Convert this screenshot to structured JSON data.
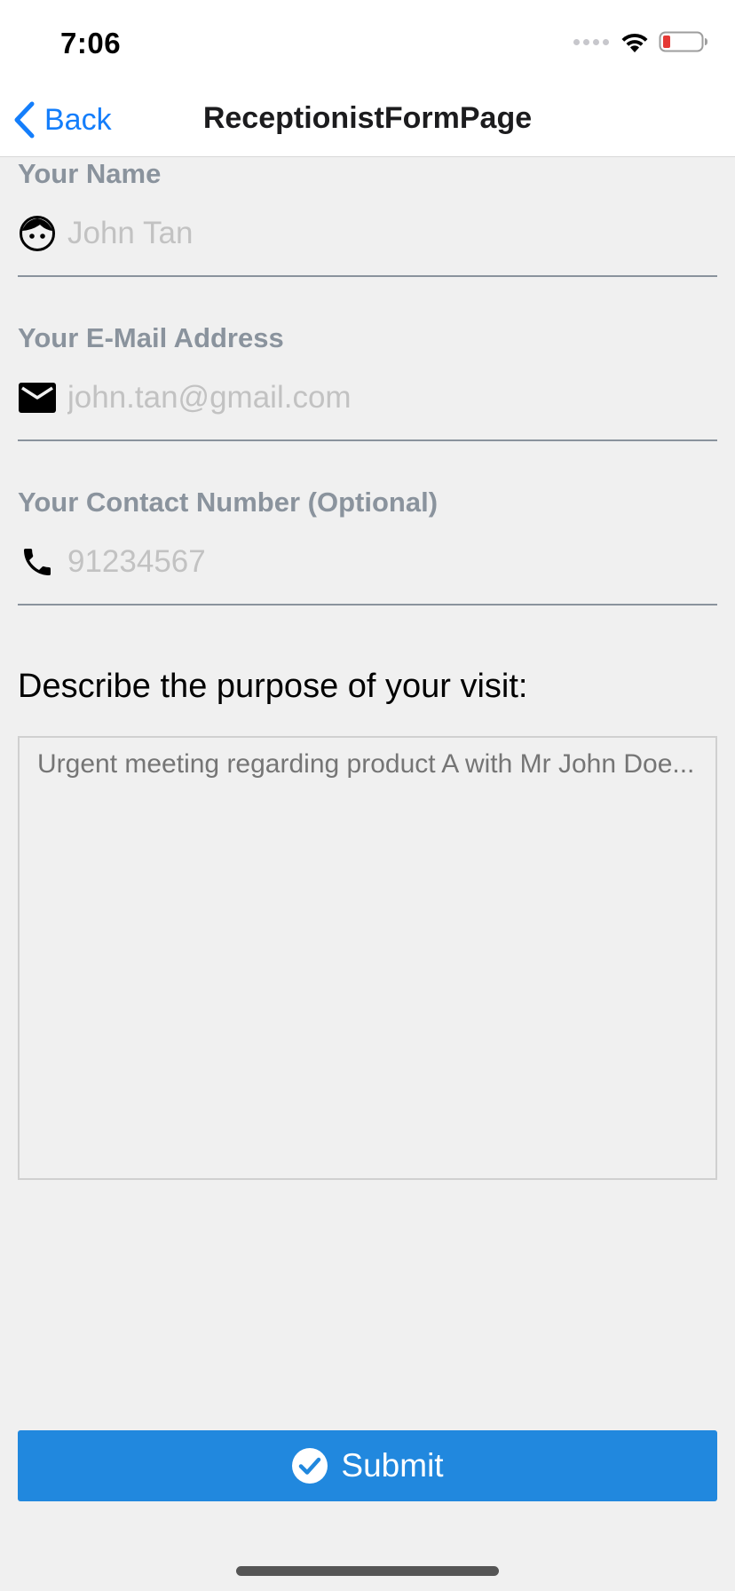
{
  "status_bar": {
    "time": "7:06",
    "icons": [
      "signal-dots-icon",
      "wifi-icon",
      "battery-low-icon"
    ],
    "battery_color": "#e53935"
  },
  "nav": {
    "back_label": "Back",
    "title": "ReceptionistFormPage",
    "accent_color": "#147efb"
  },
  "form": {
    "name": {
      "label": "Your Name",
      "placeholder": "John Tan",
      "value": "",
      "icon": "face-icon"
    },
    "email": {
      "label": "Your E-Mail Address",
      "placeholder": "john.tan@gmail.com",
      "value": "",
      "icon": "mail-icon"
    },
    "phone": {
      "label": "Your Contact Number (Optional)",
      "placeholder": "91234567",
      "value": "",
      "icon": "phone-icon"
    },
    "purpose": {
      "label": "Describe the purpose of your visit:",
      "placeholder": "Urgent meeting regarding product A with Mr John Doe...",
      "value": ""
    },
    "submit_label": "Submit",
    "submit_icon": "check-circle-icon",
    "submit_color": "#2188de"
  }
}
